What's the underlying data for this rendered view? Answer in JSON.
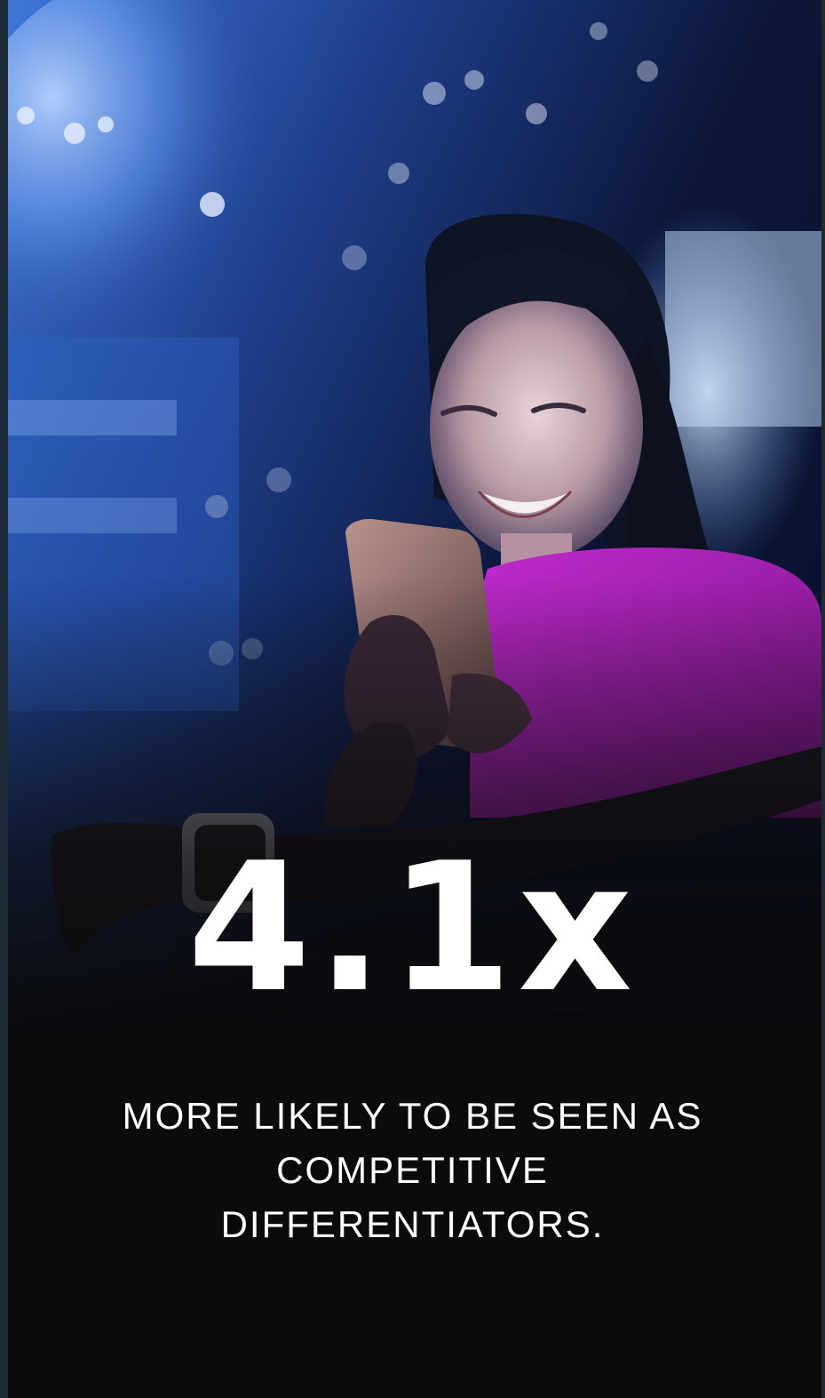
{
  "hero_image": {
    "icon": "woman-smiling-at-phone-photo",
    "colors": {
      "background": "#0b0b0c",
      "night_blue": "#1a4ea8",
      "shirt_magenta": "#a21db0",
      "frame": "#1e2a36"
    }
  },
  "stat": {
    "value": "4.1x",
    "caption": "MORE LIKELY TO BE SEEN AS COMPETITIVE DIFFERENTIATORS."
  }
}
